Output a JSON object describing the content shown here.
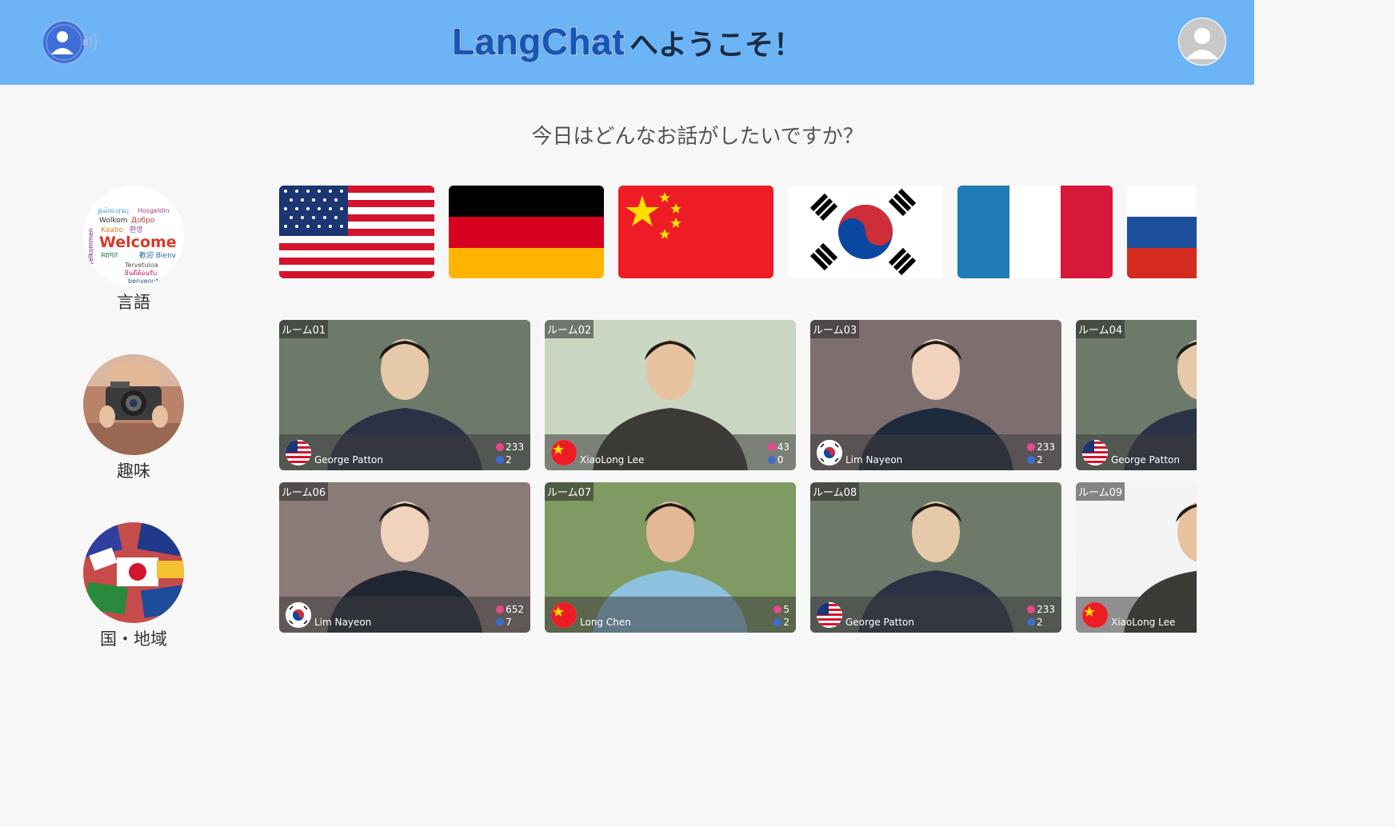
{
  "header": {
    "brand": "LangChat",
    "title_suffix": "へようこそ！",
    "logo_icon": "speaking-person-icon",
    "avatar_icon": "user-avatar-icon",
    "bg_color": "#6cb4f5"
  },
  "question": "今日はどんなお話がしたいですか？",
  "categories": [
    {
      "label": "言語",
      "icon": "welcome-words-icon"
    },
    {
      "label": "趣味",
      "icon": "camera-hobby-icon"
    },
    {
      "label": "国・地域",
      "icon": "world-flags-icon"
    }
  ],
  "language_flags": [
    "usa-flag",
    "germany-flag",
    "china-flag",
    "korea-flag",
    "france-flag",
    "russia-flag"
  ],
  "rooms": [
    {
      "tag": "ルーム01",
      "user": "George Patton",
      "flag": "usa-flag",
      "likes": "233",
      "members": "2"
    },
    {
      "tag": "ルーム02",
      "user": "XiaoLong Lee",
      "flag": "china-flag",
      "likes": "43",
      "members": "0"
    },
    {
      "tag": "ルーム03",
      "user": "Lim Nayeon",
      "flag": "korea-flag",
      "likes": "233",
      "members": "2"
    },
    {
      "tag": "ルーム04",
      "user": "George Patton",
      "flag": "usa-flag",
      "likes": "",
      "members": ""
    },
    {
      "tag": "ルーム06",
      "user": "Lim Nayeon",
      "flag": "korea-flag",
      "likes": "652",
      "members": "7"
    },
    {
      "tag": "ルーム07",
      "user": "Long Chen",
      "flag": "china-flag",
      "likes": "5",
      "members": "2"
    },
    {
      "tag": "ルーム08",
      "user": "George Patton",
      "flag": "usa-flag",
      "likes": "233",
      "members": "2"
    },
    {
      "tag": "ルーム09",
      "user": "XiaoLong Lee",
      "flag": "china-flag",
      "likes": "",
      "members": ""
    }
  ]
}
